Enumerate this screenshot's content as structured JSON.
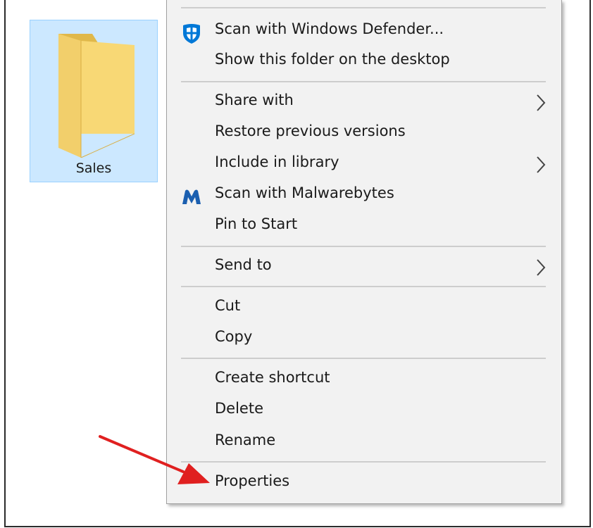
{
  "folder": {
    "name": "Sales"
  },
  "menu": {
    "items": [
      {
        "id": "scan-defender",
        "label": "Scan with Windows Defender...",
        "icon": "windows-defender-icon"
      },
      {
        "id": "show-desktop",
        "label": "Show this folder on the desktop"
      },
      {
        "id": "share-with",
        "label": "Share with",
        "submenu": true
      },
      {
        "id": "restore-versions",
        "label": "Restore previous versions"
      },
      {
        "id": "include-library",
        "label": "Include in library",
        "submenu": true
      },
      {
        "id": "scan-malwarebytes",
        "label": "Scan with Malwarebytes",
        "icon": "malwarebytes-icon"
      },
      {
        "id": "pin-start",
        "label": "Pin to Start"
      },
      {
        "id": "send-to",
        "label": "Send to",
        "submenu": true
      },
      {
        "id": "cut",
        "label": "Cut"
      },
      {
        "id": "copy",
        "label": "Copy"
      },
      {
        "id": "create-shortcut",
        "label": "Create shortcut"
      },
      {
        "id": "delete",
        "label": "Delete"
      },
      {
        "id": "rename",
        "label": "Rename"
      },
      {
        "id": "properties",
        "label": "Properties"
      }
    ]
  },
  "colors": {
    "selection_bg": "#cce8ff",
    "menu_bg": "#f2f2f2",
    "annotation_arrow": "#e02020",
    "defender_blue": "#0078d7",
    "malwarebytes_blue": "#1b5fb0"
  }
}
